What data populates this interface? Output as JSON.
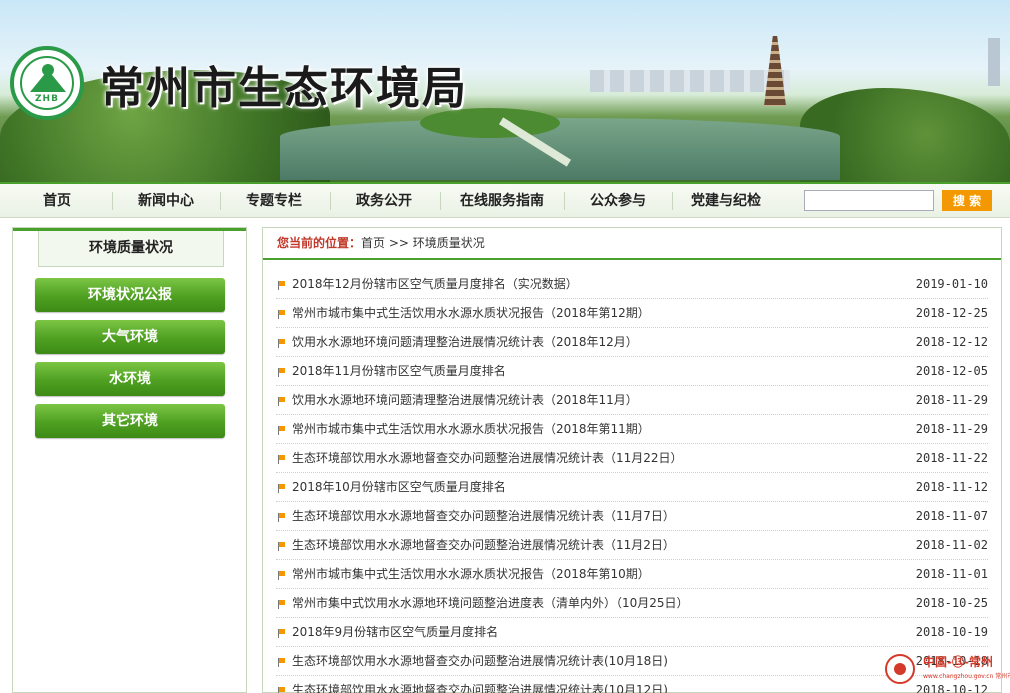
{
  "site": {
    "title": "常州市生态环境局",
    "logo_text": "ZHB"
  },
  "nav": {
    "items": [
      {
        "label": "首页"
      },
      {
        "label": "新闻中心"
      },
      {
        "label": "专题专栏"
      },
      {
        "label": "政务公开"
      },
      {
        "label": "在线服务指南"
      },
      {
        "label": "公众参与"
      },
      {
        "label": "党建与纪检"
      }
    ],
    "search_placeholder": "",
    "search_button": "搜 索"
  },
  "sidebar": {
    "heading": "环境质量状况",
    "items": [
      {
        "label": "环境状况公报"
      },
      {
        "label": "大气环境"
      },
      {
        "label": "水环境"
      },
      {
        "label": "其它环境"
      }
    ]
  },
  "breadcrumb": {
    "label": "您当前的位置：",
    "home": "首页",
    "sep": ">>",
    "current": "环境质量状况"
  },
  "articles": [
    {
      "title": "2018年12月份辖市区空气质量月度排名（实况数据）",
      "date": "2019-01-10"
    },
    {
      "title": "常州市城市集中式生活饮用水水源水质状况报告（2018年第12期）",
      "date": "2018-12-25"
    },
    {
      "title": "饮用水水源地环境问题清理整治进展情况统计表（2018年12月）",
      "date": "2018-12-12"
    },
    {
      "title": "2018年11月份辖市区空气质量月度排名",
      "date": "2018-12-05"
    },
    {
      "title": "饮用水水源地环境问题清理整治进展情况统计表（2018年11月）",
      "date": "2018-11-29"
    },
    {
      "title": "常州市城市集中式生活饮用水水源水质状况报告（2018年第11期）",
      "date": "2018-11-29"
    },
    {
      "title": "生态环境部饮用水水源地督查交办问题整治进展情况统计表（11月22日）",
      "date": "2018-11-22"
    },
    {
      "title": "2018年10月份辖市区空气质量月度排名",
      "date": "2018-11-12"
    },
    {
      "title": "生态环境部饮用水水源地督查交办问题整治进展情况统计表（11月7日）",
      "date": "2018-11-07"
    },
    {
      "title": "生态环境部饮用水水源地督查交办问题整治进展情况统计表（11月2日）",
      "date": "2018-11-02"
    },
    {
      "title": "常州市城市集中式生活饮用水水源水质状况报告（2018年第10期）",
      "date": "2018-11-01"
    },
    {
      "title": "常州市集中式饮用水水源地环境问题整治进度表（清单内外）（10月25日）",
      "date": "2018-10-25"
    },
    {
      "title": "2018年9月份辖市区空气质量月度排名",
      "date": "2018-10-19"
    },
    {
      "title": "生态环境部饮用水水源地督查交办问题整治进展情况统计表(10月18日)",
      "date": "2018-10-18"
    },
    {
      "title": "生态环境部饮用水水源地督查交办问题整治进展情况统计表(10月12日)",
      "date": "2018-10-12"
    }
  ],
  "badge": {
    "line1": "中国-⑬-常州",
    "line2": "www.changzhou.gov.cn 常州市人民政府"
  }
}
